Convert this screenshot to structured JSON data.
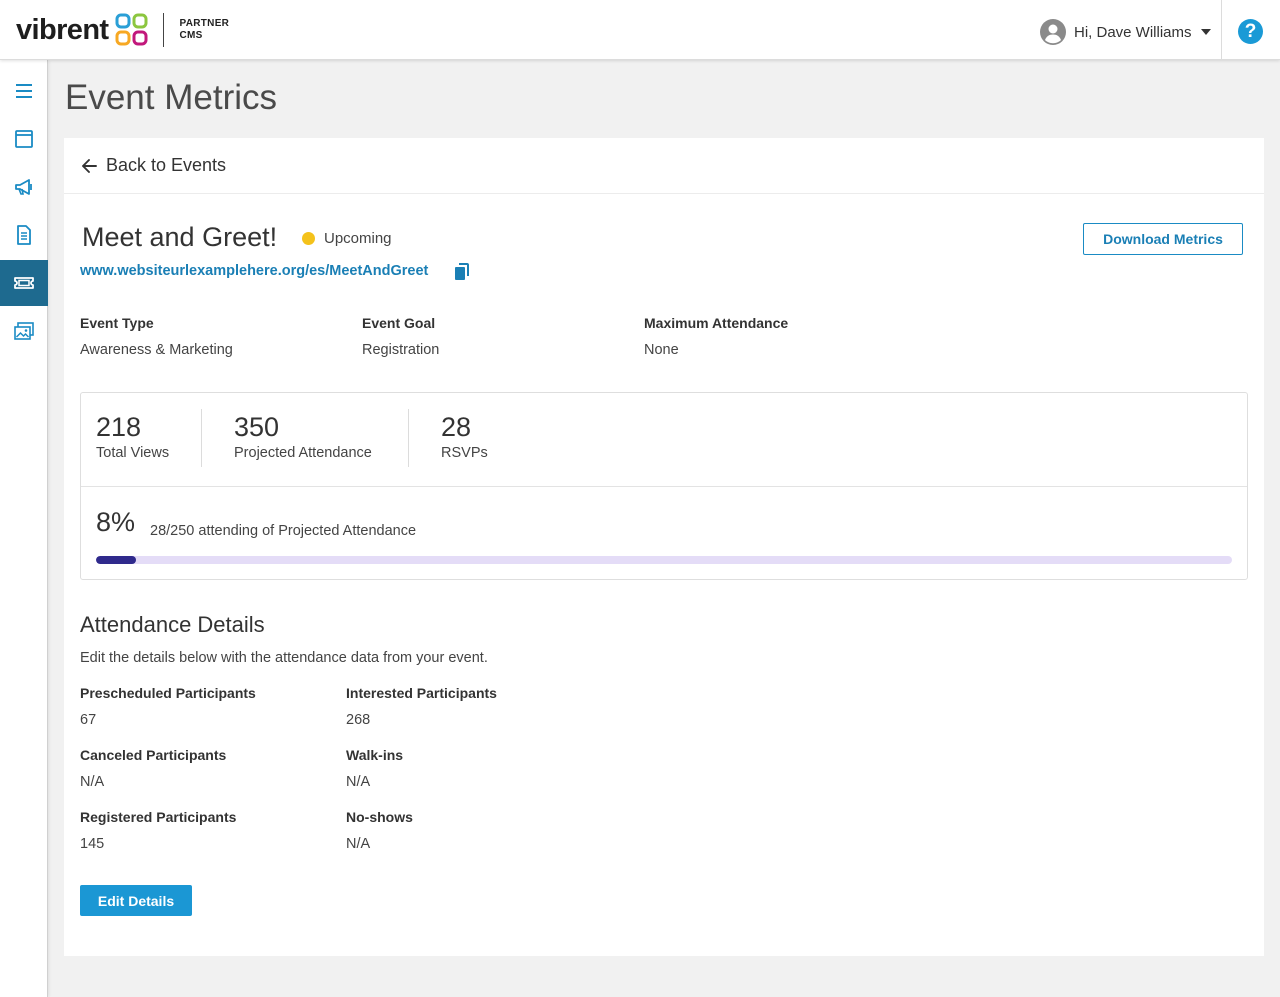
{
  "header": {
    "brand_name": "vibrent",
    "brand_sub_line1": "PARTNER",
    "brand_sub_line2": "CMS",
    "greeting": "Hi, Dave Williams",
    "help_label": "?"
  },
  "sidebar": {
    "items": [
      {
        "icon": "menu-icon",
        "active": false
      },
      {
        "icon": "browser-window-icon",
        "active": false
      },
      {
        "icon": "megaphone-icon",
        "active": false
      },
      {
        "icon": "document-icon",
        "active": false
      },
      {
        "icon": "ticket-icon",
        "active": true
      },
      {
        "icon": "gallery-icon",
        "active": false
      }
    ]
  },
  "page": {
    "title": "Event Metrics",
    "back_label": "Back to Events"
  },
  "event": {
    "title": "Meet and Greet!",
    "status": "Upcoming",
    "status_color": "#f4c21b",
    "url": "www.websiteurlexamplehere.org/es/MeetAndGreet",
    "download_label": "Download Metrics",
    "meta": [
      {
        "label": "Event Type",
        "value": "Awareness & Marketing"
      },
      {
        "label": "Event Goal",
        "value": "Registration"
      },
      {
        "label": "Maximum Attendance",
        "value": "None"
      }
    ]
  },
  "stats": {
    "items": [
      {
        "value": "218",
        "label": "Total Views"
      },
      {
        "value": "350",
        "label": "Projected Attendance"
      },
      {
        "value": "28",
        "label": "RSVPs"
      }
    ],
    "percent_label": "8%",
    "percent_value": 0.035,
    "percent_text": "28/250 attending of Projected Attendance"
  },
  "attendance": {
    "title": "Attendance Details",
    "description": "Edit the details below with the attendance data from your event.",
    "fields": [
      {
        "label": "Prescheduled Participants",
        "value": "67"
      },
      {
        "label": "Interested Participants",
        "value": "268"
      },
      {
        "label": "Canceled Participants",
        "value": "N/A"
      },
      {
        "label": "Walk-ins",
        "value": "N/A"
      },
      {
        "label": "Registered Participants",
        "value": "145"
      },
      {
        "label": "No-shows",
        "value": "N/A"
      }
    ],
    "edit_label": "Edit Details"
  },
  "colors": {
    "accent": "#1b97d4",
    "sidebar_active": "#1e6a8f",
    "progress_fill": "#2f2a8c",
    "progress_track": "#e4dcf7"
  }
}
